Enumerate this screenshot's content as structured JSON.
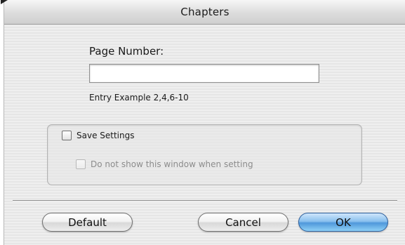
{
  "window": {
    "title": "Chapters"
  },
  "form": {
    "page_number_label": "Page Number:",
    "page_number_value": "",
    "entry_example": "Entry Example 2,4,6-10"
  },
  "options": {
    "save_settings_label": "Save Settings",
    "save_settings_checked": false,
    "do_not_show_label": "Do not show this window when setting",
    "do_not_show_checked": false,
    "do_not_show_enabled": false
  },
  "buttons": {
    "default_label": "Default",
    "cancel_label": "Cancel",
    "ok_label": "OK"
  },
  "colors": {
    "ok_button": "#5aa3e3",
    "window_background": "#ececec"
  }
}
